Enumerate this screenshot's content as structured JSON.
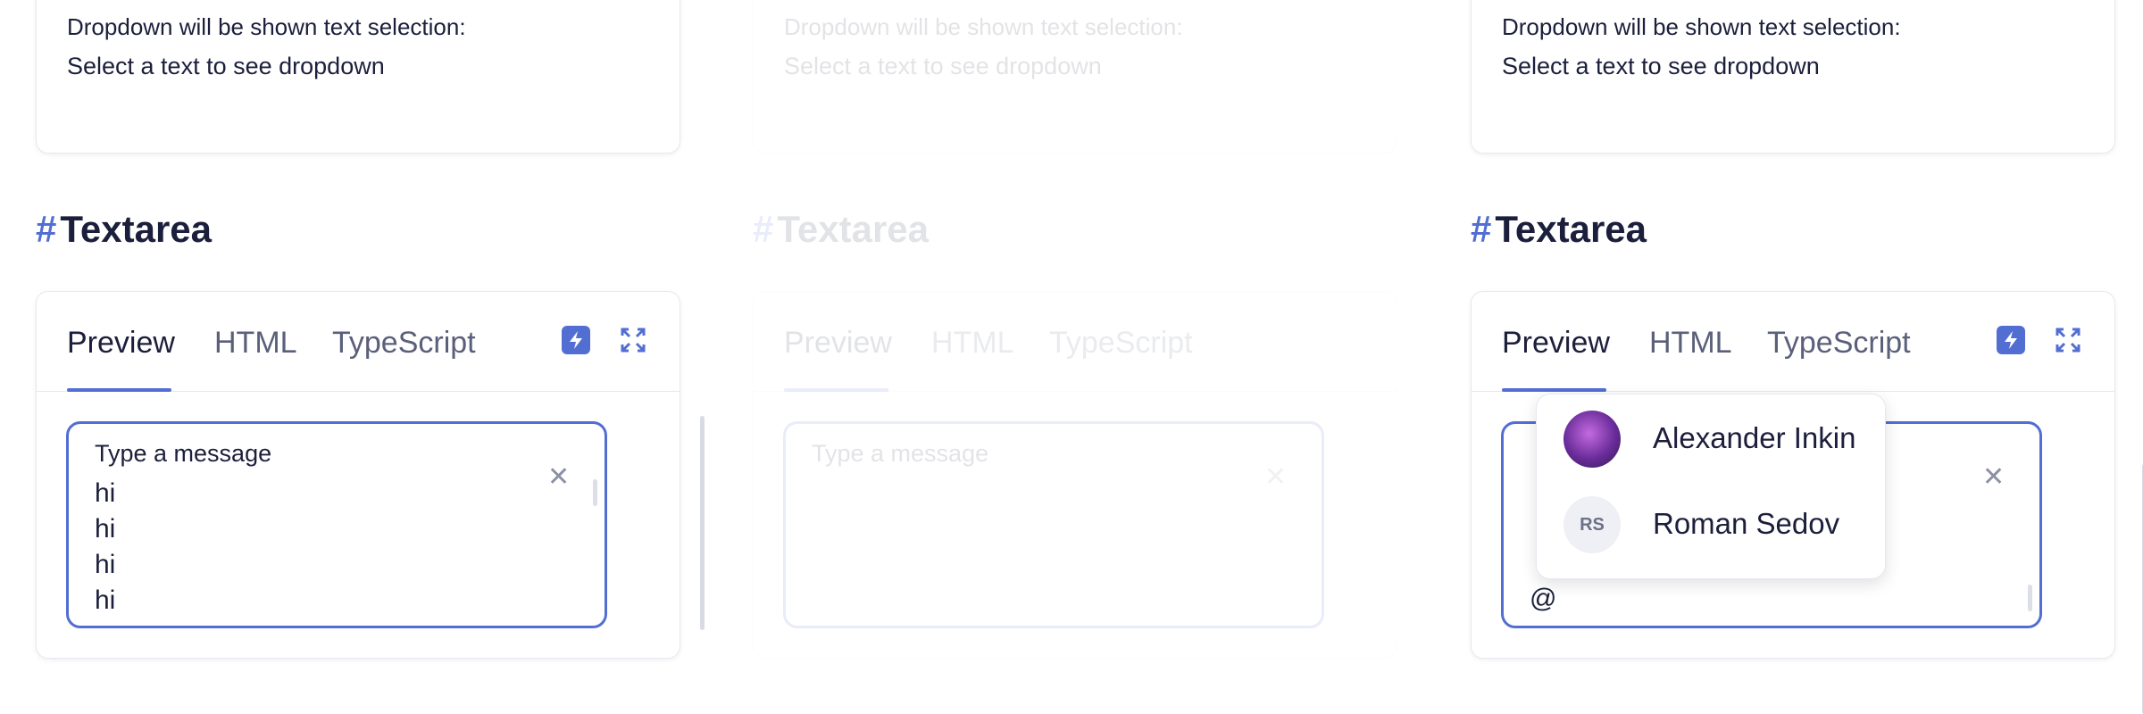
{
  "top_card": {
    "line1": "Dropdown will be shown text selection:",
    "line2": "Select a text to see dropdown"
  },
  "section": {
    "hash": "#",
    "title": "Textarea"
  },
  "tabs": [
    {
      "label": "Preview",
      "active": true
    },
    {
      "label": "HTML",
      "active": false
    },
    {
      "label": "TypeScript",
      "active": false
    }
  ],
  "icons": {
    "bolt": "lightning-icon",
    "expand": "expand-icon",
    "close": "close-icon"
  },
  "textarea": {
    "label": "Type a message",
    "clear_symbol": "✕",
    "lines": [
      "hi",
      "hi",
      "hi",
      "hi"
    ],
    "mention_trigger": "@"
  },
  "dropdown": {
    "users": [
      {
        "name": "Alexander Inkin",
        "avatar": "photo"
      },
      {
        "name": "Roman Sedov",
        "initials": "RS"
      }
    ]
  },
  "colors": {
    "accent": "#526ed3",
    "text": "#1b1f3b",
    "border": "#e6e8ef"
  }
}
